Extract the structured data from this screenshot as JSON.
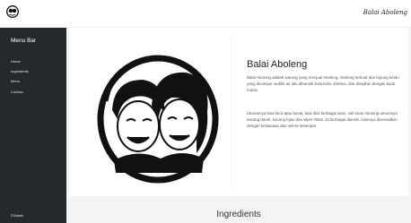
{
  "header": {
    "brand": "Balai Aboleng"
  },
  "sidebar": {
    "title": "Menu Bar",
    "items": [
      {
        "label": "Home"
      },
      {
        "label": "Ingredients"
      },
      {
        "label": "Menu"
      },
      {
        "label": "Contact"
      }
    ],
    "footer": "©Admin"
  },
  "about": {
    "title": "Balai Aboleng",
    "paragraph1": "Balai Aboleng adalah warung yang menjual Aboleng. Aboleng terbuat dari tepung ketan yang dicampur sedikit air lalu dibentuk bola-bola, direbus, dan disajikan dengan kuah manis.",
    "paragraph2": "Ukurannya bisa kecil atau besar, bisa diisi berbagai isian, nah isian Aboleng umumnya kacang tanah, kacang hijau dan wijen hitam. Di berbagai daerah, isiannya disesuaikan dengan kebiasaan dan selera setempat."
  },
  "ingredients": {
    "title": "Ingredients"
  },
  "colors": {
    "sidebar_bg": "#25292c",
    "page_bg": "#f4f4f4",
    "text": "#222222"
  },
  "icons": {
    "logo": "portrait-logo-icon",
    "hero": "portrait-illustration"
  }
}
